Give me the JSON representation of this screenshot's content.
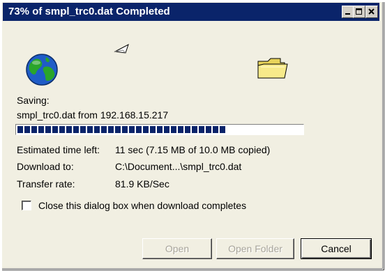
{
  "window": {
    "title": "73% of smpl_trc0.dat Completed",
    "controls": {
      "minimize": "minimize-icon",
      "maximize": "maximize-icon",
      "close": "close-icon"
    }
  },
  "icons": {
    "globe": "globe-icon",
    "paper": "flying-paper-icon",
    "folder": "folder-icon"
  },
  "status": {
    "saving_label": "Saving:",
    "file_from": "smpl_trc0.dat from 192.168.15.217",
    "progress_fraction": 0.73
  },
  "details": {
    "estimated_label": "Estimated time left:",
    "estimated_value": "11 sec (7.15 MB of 10.0 MB copied)",
    "download_label": "Download to:",
    "download_value": "C:\\Document...\\smpl_trc0.dat",
    "rate_label": "Transfer rate:",
    "rate_value": "81.9 KB/Sec"
  },
  "options": {
    "close_on_complete_label": "Close this dialog box when download completes",
    "close_on_complete_checked": false
  },
  "buttons": {
    "open": "Open",
    "open_folder": "Open Folder",
    "cancel": "Cancel"
  },
  "colors": {
    "titlebar": "#0a246a",
    "dialog_bg": "#f1efe2",
    "progress": "#0a246a"
  }
}
